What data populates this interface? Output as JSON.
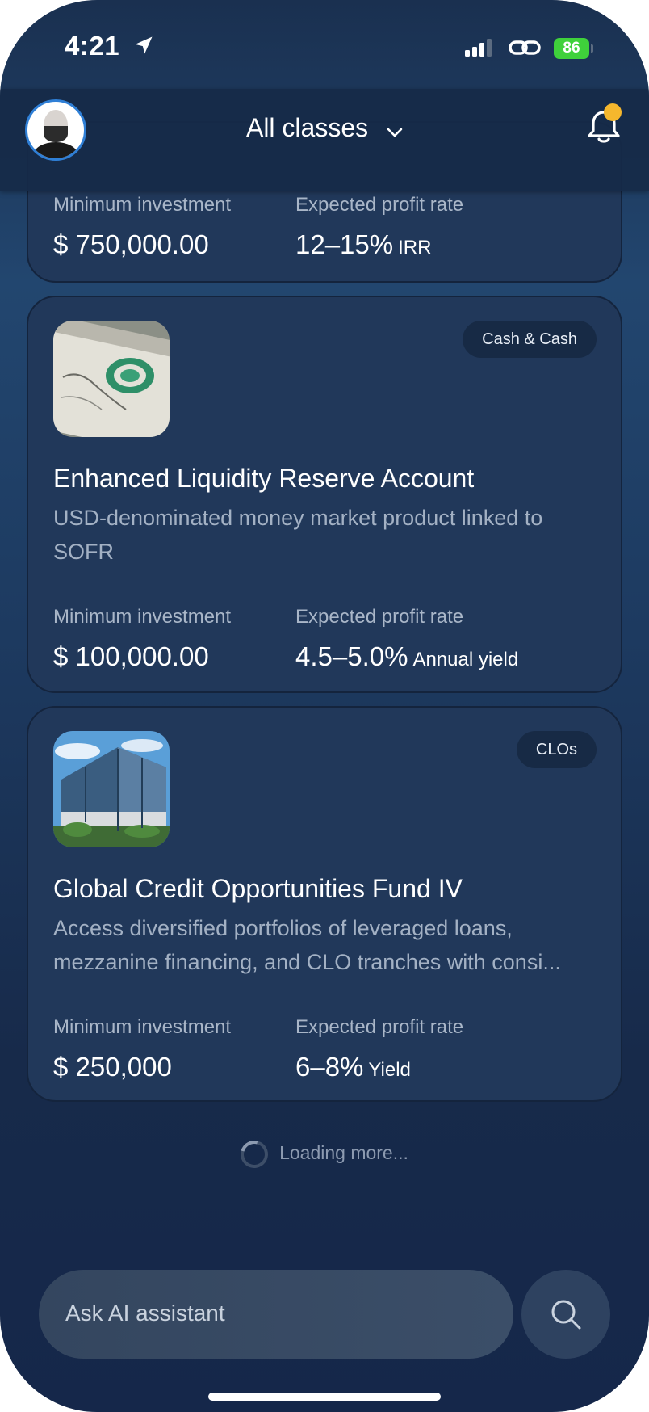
{
  "status_bar": {
    "time": "4:21",
    "battery": "86",
    "icons": [
      "location-arrow-icon",
      "signal-icon",
      "link-icon",
      "battery-icon"
    ]
  },
  "header": {
    "class_filter": "All classes",
    "icons": [
      "avatar",
      "chevron-down-icon",
      "bell-icon"
    ],
    "colors": {
      "notification_dot": "#f5b72d",
      "avatar_ring": "#2f7fd6"
    }
  },
  "cards": [
    {
      "min_label": "Minimum investment",
      "min_value": "$ 750,000.00",
      "rate_label": "Expected profit rate",
      "rate_value": "12–15%",
      "rate_unit": "IRR"
    },
    {
      "badge": "Cash & Cash",
      "title": "Enhanced Liquidity Reserve Account",
      "description": "USD-denominated money market product linked to SOFR",
      "min_label": "Minimum investment",
      "min_value": "$ 100,000.00",
      "rate_label": "Expected profit rate",
      "rate_value": "4.5–5.0%",
      "rate_unit": "Annual yield"
    },
    {
      "badge": "CLOs",
      "title": "Global Credit Opportunities Fund IV",
      "description": "Access diversified portfolios of leveraged loans, mezzanine financing, and CLO tranches with consi...",
      "min_label": "Minimum investment",
      "min_value": "$ 250,000",
      "rate_label": "Expected profit rate",
      "rate_value": "6–8%",
      "rate_unit": "Yield"
    }
  ],
  "loading_text": "Loading more...",
  "ai_bar": {
    "placeholder": "Ask AI assistant",
    "search_icon": "search-icon"
  },
  "colors": {
    "background": "#1d3a60",
    "card": "#21385a",
    "muted_text": "#a3b1c4",
    "battery": "#3fd13b"
  }
}
